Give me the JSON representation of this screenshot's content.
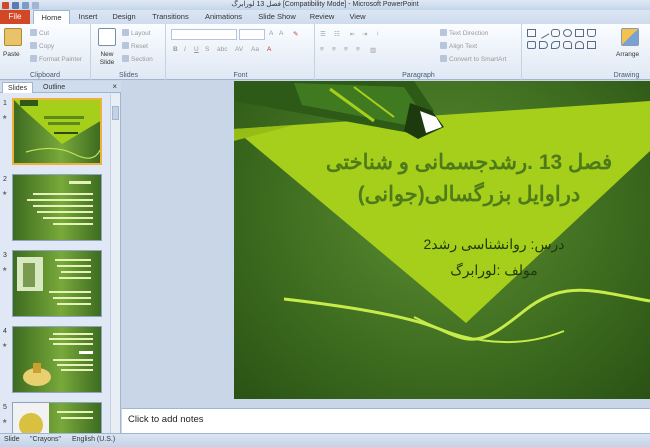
{
  "window": {
    "title": "فصل 13 لورابرگ [Compatibility Mode] - Microsoft PowerPoint"
  },
  "ribbon_tabs": [
    "Home",
    "Insert",
    "Design",
    "Transitions",
    "Animations",
    "Slide Show",
    "Review",
    "View"
  ],
  "file_tab": "File",
  "ribbon": {
    "clipboard": {
      "paste": "Paste",
      "cut": "Cut",
      "copy": "Copy",
      "format_painter": "Format Painter",
      "label": "Clipboard"
    },
    "slides": {
      "new_slide": "New Slide",
      "layout": "Layout",
      "reset": "Reset",
      "section": "Section",
      "label": "Slides"
    },
    "font": {
      "label": "Font"
    },
    "paragraph": {
      "text_direction": "Text Direction",
      "align_text": "Align Text",
      "smartart": "Convert to SmartArt",
      "label": "Paragraph"
    },
    "drawing": {
      "arrange": "Arrange",
      "label": "Drawing"
    }
  },
  "pane": {
    "tab_slides": "Slides",
    "tab_outline": "Outline",
    "close": "×",
    "thumb_numbers": [
      "1",
      "2",
      "3",
      "4",
      "5"
    ]
  },
  "slide": {
    "title_line1": "فصل 13 .رشدجسمانی و شناختی",
    "title_line2": "دراوایل بزرگسالی(جوانی)",
    "course": "درس: روانشناسی رشد2",
    "author": "مولف :لورابرگ",
    "colors": {
      "light_green": "#a6cf1c",
      "dark_green": "#2d5a17",
      "title": "#4e7a1a"
    }
  },
  "notes": {
    "placeholder": "Click to add notes"
  },
  "statusbar": {
    "slide": "Slide",
    "theme": "\"Crayons\"",
    "language": "English (U.S.)"
  }
}
